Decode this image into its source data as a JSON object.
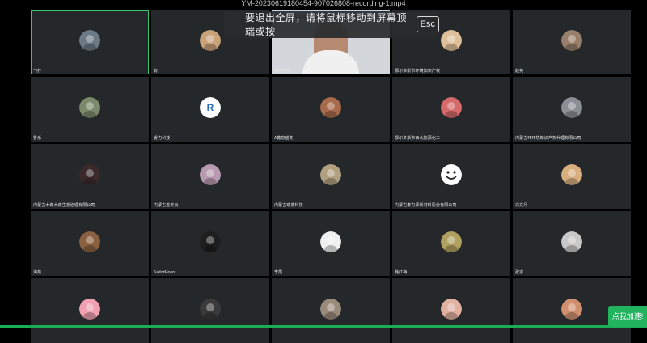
{
  "window": {
    "title": "YM-20230619180454-907026808-recording-1.mp4"
  },
  "fullscreen_toast": {
    "message": "要退出全屏，请将鼠标移动到屏幕顶端或按",
    "key": "Esc"
  },
  "participants": [
    {
      "name": "飞打",
      "avatar": "mountain-avatar-icon",
      "active": true
    },
    {
      "name": "有",
      "avatar": "anime-girl-avatar-icon"
    },
    {
      "name": "鑫德钢党",
      "avatar": "video-feed",
      "banner": "鄂尔多斯市鑫德钢铁有限责任公司"
    },
    {
      "name": "鄂尔多斯市环境知识产权",
      "avatar": "cartoon-boy-avatar-icon"
    },
    {
      "name": "赵英",
      "avatar": "cartoon-girl-avatar-icon"
    },
    {
      "name": "鲁乐",
      "avatar": "cartoon-face-avatar-icon"
    },
    {
      "name": "睿力科技",
      "avatar": "company-logo-avatar-icon"
    },
    {
      "name": "A鑫泉盛冬",
      "avatar": "portrait-avatar-icon"
    },
    {
      "name": "鄂尔多斯市西北能源化工",
      "avatar": "cartoon-kid-avatar-icon"
    },
    {
      "name": "内蒙古环环境知识产权代理有限公司",
      "avatar": "animal-avatar-icon"
    },
    {
      "name": "内蒙古木森木森生态治理有限公司",
      "avatar": "girl-photo-avatar-icon"
    },
    {
      "name": "内蒙古善美云",
      "avatar": "character-avatar-icon"
    },
    {
      "name": "内蒙古瑞德科技",
      "avatar": "dog-avatar-icon"
    },
    {
      "name": "内蒙古泰力泽新材料股份有限公司",
      "avatar": "smiley-avatar-icon"
    },
    {
      "name": "白文月",
      "avatar": "illustrated-boy-avatar-icon"
    },
    {
      "name": "海燕",
      "avatar": "sunset-avatar-icon"
    },
    {
      "name": "SailorMoon",
      "avatar": "dark-figure-avatar-icon"
    },
    {
      "name": "李霞",
      "avatar": "anime-avatar-icon"
    },
    {
      "name": "韩红梅",
      "avatar": "landscape-avatar-icon"
    },
    {
      "name": "张宇",
      "avatar": "ghost-avatar-icon"
    },
    {
      "name": "",
      "avatar": "pink-hair-avatar-icon"
    },
    {
      "name": "",
      "avatar": "hat-avatar-icon"
    },
    {
      "name": "",
      "avatar": "cat-avatar-icon"
    },
    {
      "name": "",
      "avatar": "girl-avatar-icon"
    },
    {
      "name": "",
      "avatar": "couple-avatar-icon"
    }
  ],
  "join_button": {
    "label": "点我加速!"
  },
  "playback": {
    "progress": 1.0
  }
}
